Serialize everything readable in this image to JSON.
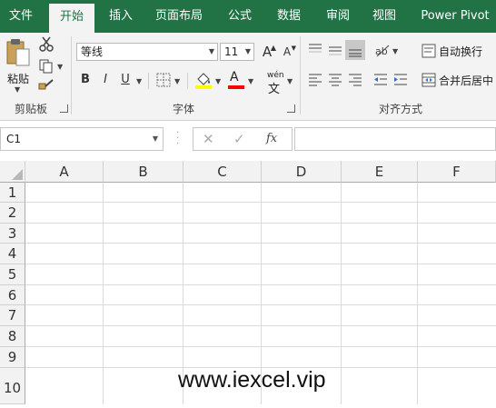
{
  "tabs": [
    "文件",
    "开始",
    "插入",
    "页面布局",
    "公式",
    "数据",
    "审阅",
    "视图",
    "Power Pivot"
  ],
  "active_tab_index": 1,
  "clipboard": {
    "paste_label": "粘贴",
    "group_label": "剪贴板"
  },
  "font": {
    "name": "等线",
    "size": "11",
    "bold": "B",
    "italic": "I",
    "underline": "U",
    "grow": "A",
    "shrink": "A",
    "phonetic_top": "wén",
    "phonetic_bottom": "文",
    "font_color_letter": "A",
    "group_label": "字体"
  },
  "alignment": {
    "wrap_text": "自动换行",
    "merge_center": "合并后居中",
    "group_label": "对齐方式"
  },
  "formula_bar": {
    "name_box": "C1",
    "cancel": "✕",
    "enter": "✓",
    "fx": "fx",
    "value": ""
  },
  "columns": [
    "A",
    "B",
    "C",
    "D",
    "E",
    "F"
  ],
  "rows": [
    "1",
    "2",
    "3",
    "4",
    "5",
    "6",
    "7",
    "8",
    "9",
    "10"
  ],
  "watermark": "www.iexcel.vip",
  "colors": {
    "ribbon_green": "#217346",
    "highlight_yellow": "#ffff00",
    "font_red": "#ff0000"
  }
}
